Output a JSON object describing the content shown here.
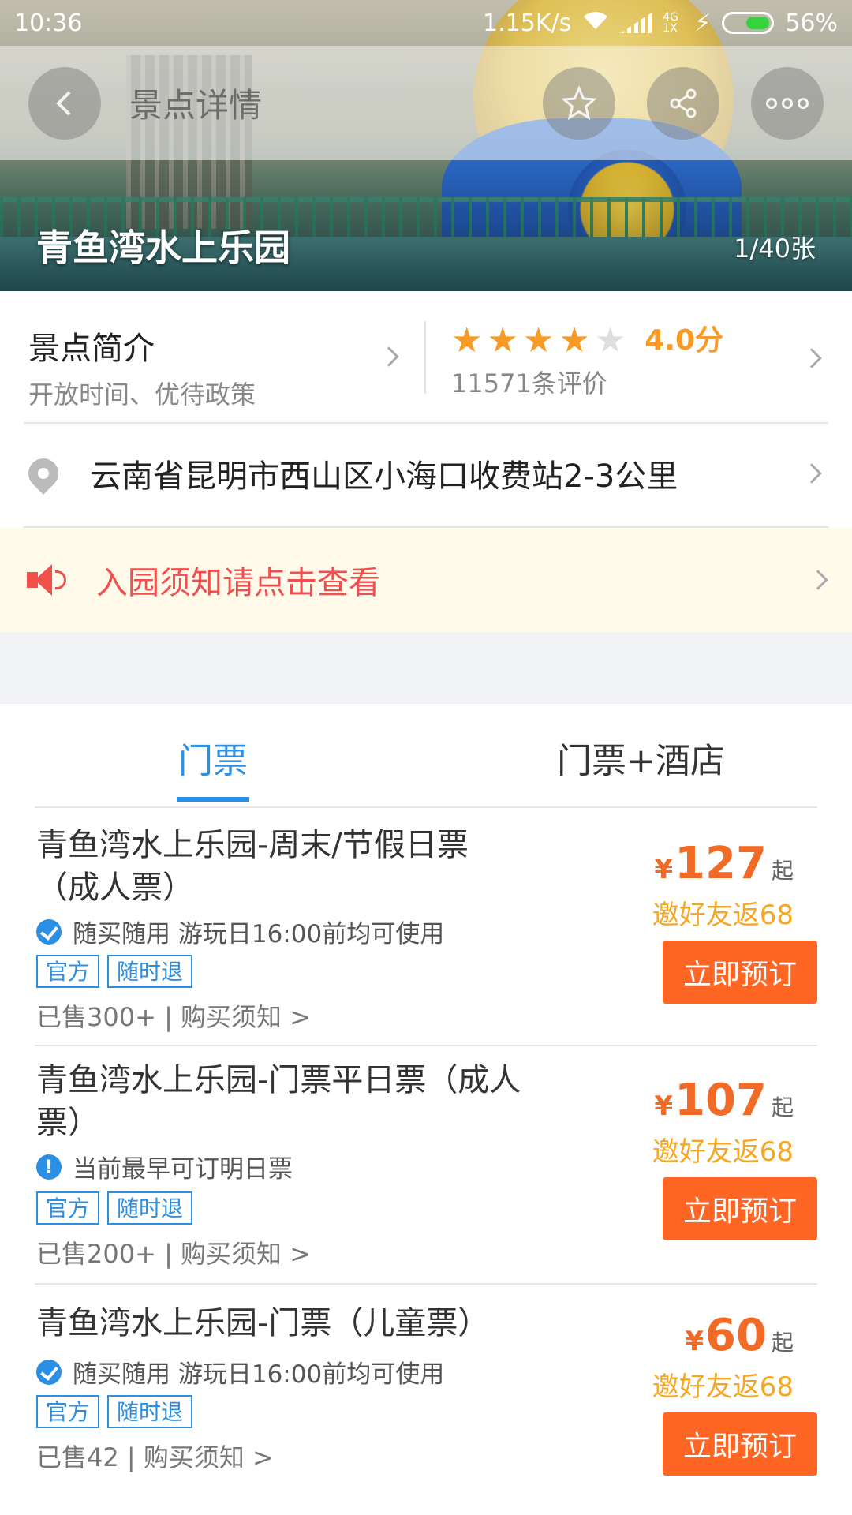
{
  "status_bar": {
    "time": "10:36",
    "speed": "1.15K/s",
    "network": "4G 1X",
    "battery": "56%"
  },
  "title_bar": {
    "title": "景点详情",
    "icons": [
      "back-arrow-icon",
      "star-outline-icon",
      "share-icon",
      "more-dots-icon"
    ]
  },
  "hero": {
    "attraction_name": "青鱼湾水上乐园",
    "photo_count": "1/40张"
  },
  "intro": {
    "heading": "景点简介",
    "subtitle": "开放时间、优待政策"
  },
  "rating": {
    "stars_filled": 4,
    "stars_total": 5,
    "score": "4.0分",
    "reviews": "11571条评价"
  },
  "address": "云南省昆明市西山区小海口收费站2-3公里",
  "notice": "入园须知请点击查看",
  "tabs": [
    {
      "label": "门票",
      "active": true
    },
    {
      "label": "门票+酒店",
      "active": false
    }
  ],
  "tickets": [
    {
      "name": "青鱼湾水上乐园-周末/节假日票（成人票）",
      "feature_icon": "check-circle-icon",
      "feature": "随买随用 游玩日16:00前均可使用",
      "tags": [
        "官方",
        "随时退"
      ],
      "sold": "已售300+ | 购买须知 >",
      "currency": "¥",
      "price": "127",
      "price_suffix": "起",
      "rebate": "邀好友返68",
      "button": "立即预订"
    },
    {
      "name": "青鱼湾水上乐园-门票平日票（成人票）",
      "feature_icon": "info-circle-icon",
      "feature": "当前最早可订明日票",
      "tags": [
        "官方",
        "随时退"
      ],
      "sold": "已售200+ | 购买须知 >",
      "currency": "¥",
      "price": "107",
      "price_suffix": "起",
      "rebate": "邀好友返68",
      "button": "立即预订"
    },
    {
      "name": "青鱼湾水上乐园-门票（儿童票）",
      "feature_icon": "check-circle-icon",
      "feature": "随买随用 游玩日16:00前均可使用",
      "tags": [
        "官方",
        "随时退"
      ],
      "sold": "已售42 | 购买须知 >",
      "currency": "¥",
      "price": "60",
      "price_suffix": "起",
      "rebate": "邀好友返68",
      "button": "立即预订"
    }
  ],
  "colors": {
    "accent_blue": "#2b8fe4",
    "price_orange": "#f26b26",
    "button_orange": "#ff6523",
    "star_orange": "#f79a26",
    "notice_red": "#ef4f4f",
    "rebate_yellow": "#f5a623"
  }
}
